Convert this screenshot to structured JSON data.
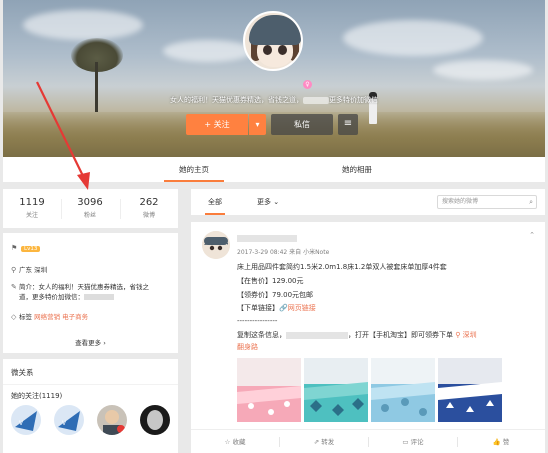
{
  "profile": {
    "bio_prefix": "女人的福利！天猫优惠券精选，省钱之道，",
    "bio_suffix": "更多特价加微信",
    "gender_symbol": "♀"
  },
  "actions": {
    "follow_label": "+ 关注",
    "follow_dropdown": "▾",
    "message_label": "私信",
    "more_label": "≡"
  },
  "profile_tabs": [
    {
      "label": "她的主页",
      "active": true
    },
    {
      "label": "她的相册",
      "active": false
    }
  ],
  "stats": [
    {
      "num": "1119",
      "label": "关注"
    },
    {
      "num": "3096",
      "label": "粉丝"
    },
    {
      "num": "262",
      "label": "微博"
    }
  ],
  "info": {
    "level_badge": "Lv13",
    "location": "广东 深圳",
    "intro_line1": "简介：女人的福利！天猫优惠券精选，省钱之",
    "intro_line2": "道，更多特价加微信：",
    "tags_label": "标签",
    "tags": "网络营销 电子商务",
    "view_more": "查看更多 ›"
  },
  "relations": {
    "title": "微关系",
    "follow_count": "她的关注(1119)"
  },
  "feed_tabs": {
    "all": "全部",
    "more": "更多",
    "more_caret": "⌄",
    "search_placeholder": "搜索她的微博"
  },
  "post": {
    "meta": "2017-3-29 08:42 来自 小米Note",
    "line1": "床上用品四件套简约1.5米2.0m1.8床1.2单双人被套床单加厚4件套",
    "line2": "【在售价】129.00元",
    "line3": "【领券价】79.00元包邮",
    "line4_prefix": "【下单链接】",
    "line4_link": "网页链接",
    "divider": "----------------",
    "line6_prefix": "复制这条信息，",
    "line6_mid": "，打开【手机淘宝】即可领券下单",
    "line6_location": "深圳",
    "line7_link": "翻身路",
    "collapse_icon": "⌃"
  },
  "post_actions": [
    {
      "icon": "☆",
      "label": "收藏",
      "name": "favorite"
    },
    {
      "icon": "⇗",
      "label": "转发",
      "name": "repost"
    },
    {
      "icon": "▭",
      "label": "评论",
      "name": "comment"
    },
    {
      "icon": "👍",
      "label": "赞",
      "name": "like"
    }
  ],
  "colors": {
    "accent": "#ff8140",
    "link": "#eb7350",
    "annotation_arrow": "#e53935"
  }
}
